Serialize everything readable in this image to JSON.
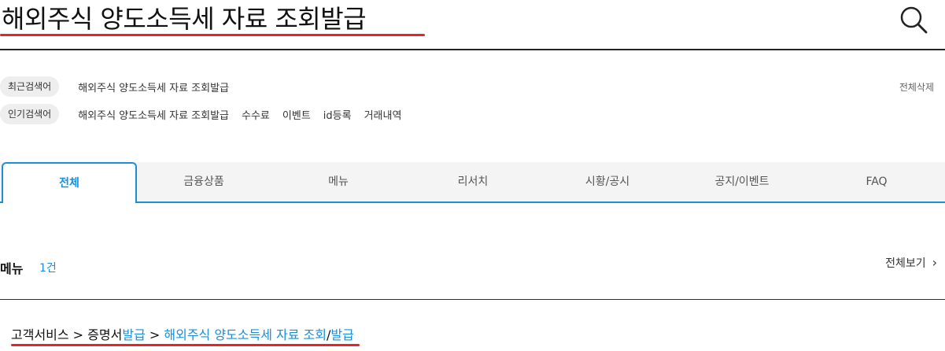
{
  "search": {
    "query": "해외주식 양도소득세 자료 조회발급",
    "underline_color": "#e8232a",
    "icon": "search-icon"
  },
  "recent": {
    "label": "최근검색어",
    "items": [
      "해외주식 양도소득세 자료 조회발급"
    ],
    "delete_all": "전체삭제"
  },
  "popular": {
    "label": "인기검색어",
    "items": [
      "해외주식 양도소득세 자료 조회발급",
      "수수료",
      "이벤트",
      "id등록",
      "거래내역"
    ]
  },
  "tabs": [
    {
      "label": "전체",
      "active": true
    },
    {
      "label": "금융상품",
      "active": false
    },
    {
      "label": "메뉴",
      "active": false
    },
    {
      "label": "리서치",
      "active": false
    },
    {
      "label": "시황/공시",
      "active": false
    },
    {
      "label": "공지/이벤트",
      "active": false
    },
    {
      "label": "FAQ",
      "active": false
    }
  ],
  "accent_color": "#1a8fd8",
  "section": {
    "title": "메뉴",
    "count": "1건",
    "view_all": "전체보기",
    "view_all_icon": "chevron-right-icon"
  },
  "result": {
    "parts": [
      {
        "text": "고객서비스 > 증명서",
        "tone": "dark"
      },
      {
        "text": "발급",
        "tone": "blue"
      },
      {
        "text": " > ",
        "tone": "dark"
      },
      {
        "text": "해외주식 양도소득세 자료 조회",
        "tone": "blue"
      },
      {
        "text": "/",
        "tone": "dark"
      },
      {
        "text": "발급",
        "tone": "blue"
      }
    ]
  }
}
